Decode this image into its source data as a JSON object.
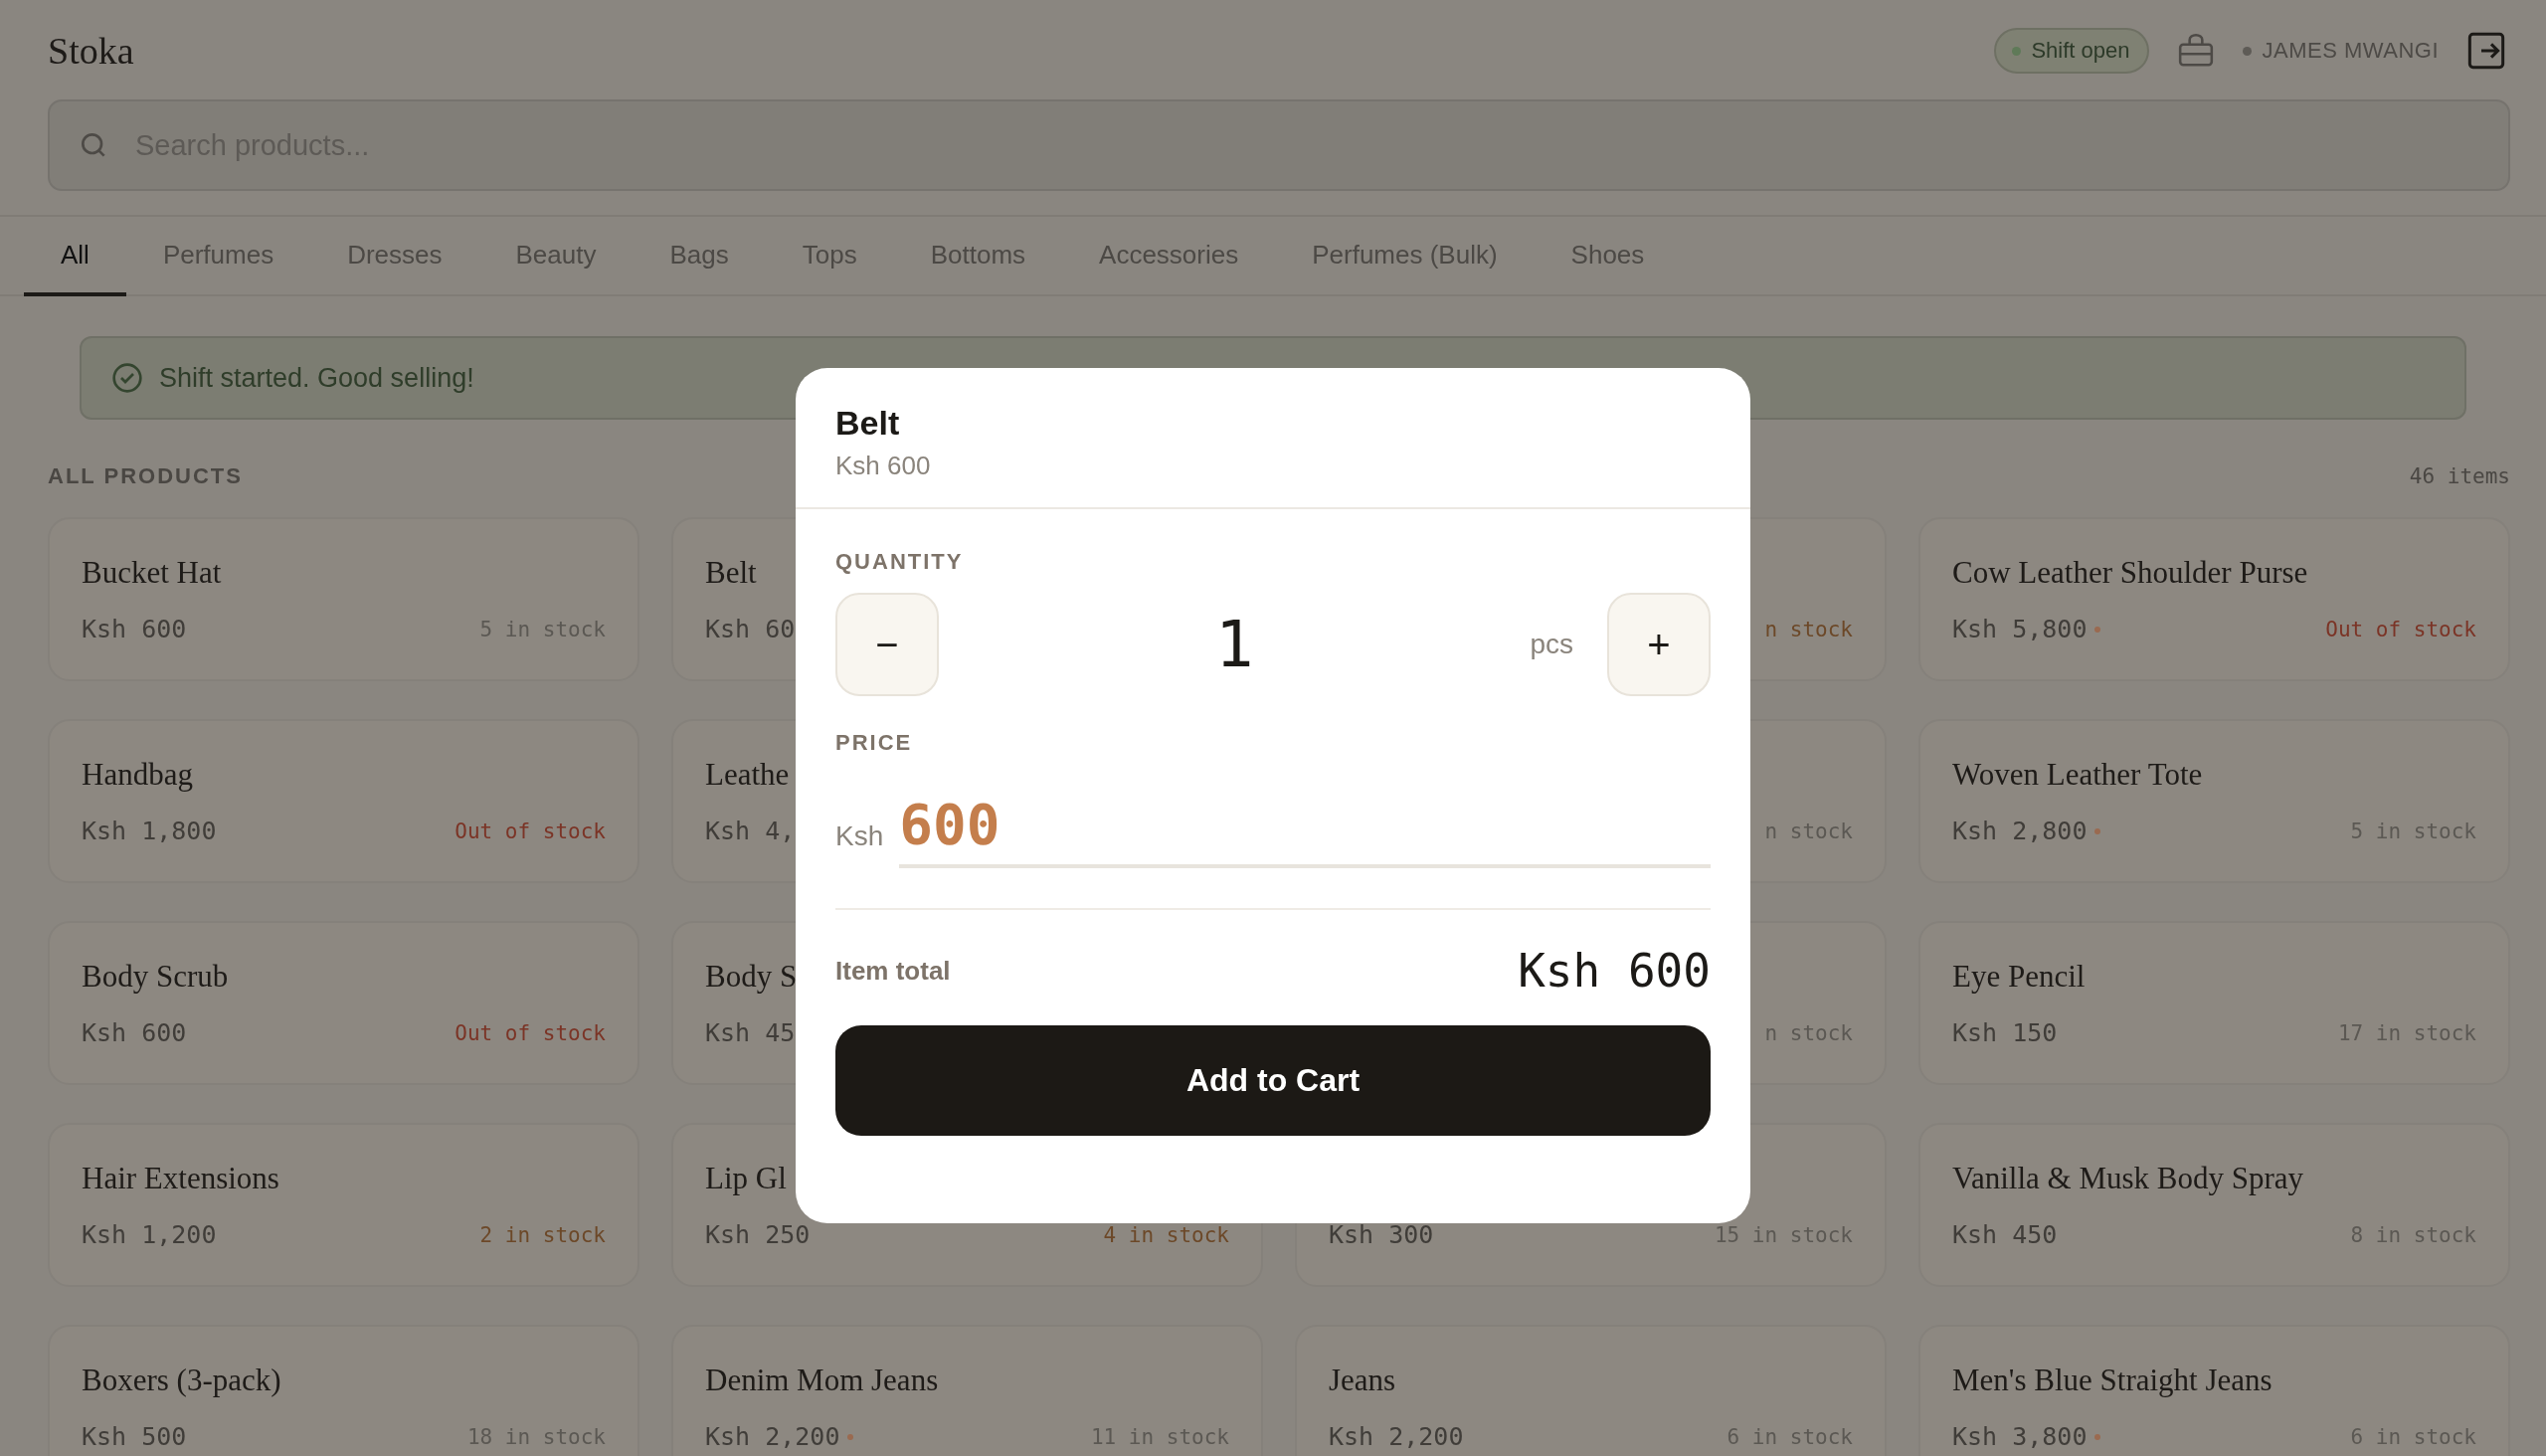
{
  "header": {
    "logo": "Stoka",
    "shift_badge": {
      "label": "Shift open",
      "on": true
    },
    "user": {
      "name": "JAMES MWANGI",
      "online": true
    }
  },
  "search": {
    "placeholder": "Search products..."
  },
  "tabs": [
    {
      "label": "All",
      "selected": true
    },
    {
      "label": "Perfumes",
      "selected": false
    },
    {
      "label": "Dresses",
      "selected": false
    },
    {
      "label": "Beauty",
      "selected": false
    },
    {
      "label": "Bags",
      "selected": false
    },
    {
      "label": "Tops",
      "selected": false
    },
    {
      "label": "Bottoms",
      "selected": false
    },
    {
      "label": "Accessories",
      "selected": false
    },
    {
      "label": "Perfumes (Bulk)",
      "selected": false
    },
    {
      "label": "Shoes",
      "selected": false
    }
  ],
  "banner": {
    "text": "Shift started. Good selling!"
  },
  "section": {
    "title": "ALL PRODUCTS",
    "count": "46 items"
  },
  "products": [
    {
      "name": "Bucket Hat",
      "price": "Ksh 600",
      "flagged": false,
      "stock": "5 in stock",
      "kind": "normal"
    },
    {
      "name": "Belt",
      "price": "Ksh 60",
      "flagged": false
    },
    {
      "stock": "n stock",
      "kind": "low"
    },
    {
      "name": "Cow Leather Shoulder Purse",
      "price": "Ksh 5,800",
      "flagged": true,
      "stock": "Out of stock",
      "kind": "out"
    },
    {
      "name": "Handbag",
      "price": "Ksh 1,800",
      "flagged": false,
      "stock": "Out of stock",
      "kind": "out"
    },
    {
      "name": "Leathe",
      "price": "Ksh 4,",
      "flagged": false
    },
    {
      "stock": "n stock",
      "kind": "normal"
    },
    {
      "name": "Woven Leather Tote",
      "price": "Ksh 2,800",
      "flagged": true,
      "stock": "5 in stock",
      "kind": "normal"
    },
    {
      "name": "Body Scrub",
      "price": "Ksh 600",
      "flagged": false,
      "stock": "Out of stock",
      "kind": "out"
    },
    {
      "name": "Body S",
      "price": "Ksh 45",
      "flagged": false
    },
    {
      "stock": "n stock",
      "kind": "normal"
    },
    {
      "name": "Eye Pencil",
      "price": "Ksh 150",
      "flagged": false,
      "stock": "17 in stock",
      "kind": "normal"
    },
    {
      "name": "Hair Extensions",
      "price": "Ksh 1,200",
      "flagged": false,
      "stock": "2 in stock",
      "kind": "low"
    },
    {
      "name": "Lip Gl",
      "price": "Ksh 250",
      "flagged": false,
      "stock": "4 in stock",
      "kind": "low"
    },
    {
      "price": "Ksh 300",
      "flagged": false,
      "stock": "15 in stock",
      "kind": "normal"
    },
    {
      "name": "Vanilla & Musk Body Spray",
      "price": "Ksh 450",
      "flagged": false,
      "stock": "8 in stock",
      "kind": "normal"
    },
    {
      "name": "Boxers (3-pack)",
      "price": "Ksh 500",
      "flagged": false,
      "stock": "18 in stock",
      "kind": "normal"
    },
    {
      "name": "Denim Mom Jeans",
      "price": "Ksh 2,200",
      "flagged": true,
      "stock": "11 in stock",
      "kind": "normal"
    },
    {
      "name": "Jeans",
      "price": "Ksh 2,200",
      "flagged": false,
      "stock": "6 in stock",
      "kind": "normal"
    },
    {
      "name": "Men's Blue Straight Jeans",
      "price": "Ksh 3,800",
      "flagged": true,
      "stock": "6 in stock",
      "kind": "normal"
    }
  ],
  "modal": {
    "title": "Belt",
    "subtitle": "Ksh 600",
    "quantity_label": "QUANTITY",
    "minus": "−",
    "quantity": "1",
    "unit": "pcs",
    "plus": "+",
    "price_label": "PRICE",
    "currency": "Ksh",
    "price_value": "600",
    "total_label": "Item total",
    "total": "Ksh 600",
    "button": "Add to Cart"
  }
}
